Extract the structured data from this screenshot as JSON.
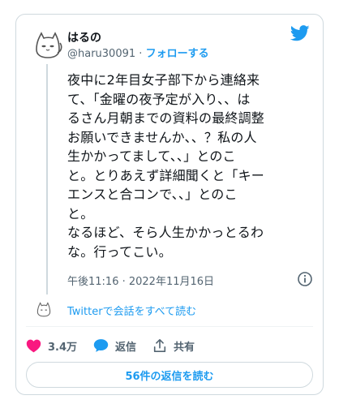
{
  "user": {
    "display_name": "はるの",
    "handle": "@haru30091",
    "separator": " · ",
    "follow_label": "フォローする"
  },
  "tweet": {
    "text": "夜中に2年目女子部下から連絡来\nて、「金曜の夜予定が入り、、は\nるさん月朝までの資料の最終調整\nお願いできませんか、、？私の人\n生かかってまして、、」とのこ\nと。とりあえず詳細聞くと「キー\nエンスと合コンで、、」とのこ\nと。\nなるほど、そら人生かかっとるわ\nな。行ってこい。",
    "timestamp": "午後11:16 · 2022年11月16日"
  },
  "thread": {
    "read_all_label": "Twitterで会話をすべて読む"
  },
  "actions": {
    "likes": "3.4万",
    "reply_label": "返信",
    "share_label": "共有"
  },
  "replies_button": {
    "label": "56件の返信を読む"
  },
  "colors": {
    "accent": "#1d9bf0",
    "like": "#f91880",
    "muted": "#536471"
  },
  "icons": [
    "cat-avatar",
    "twitter-bird-icon",
    "info-icon",
    "heart-icon",
    "reply-bubble-icon",
    "share-icon"
  ]
}
